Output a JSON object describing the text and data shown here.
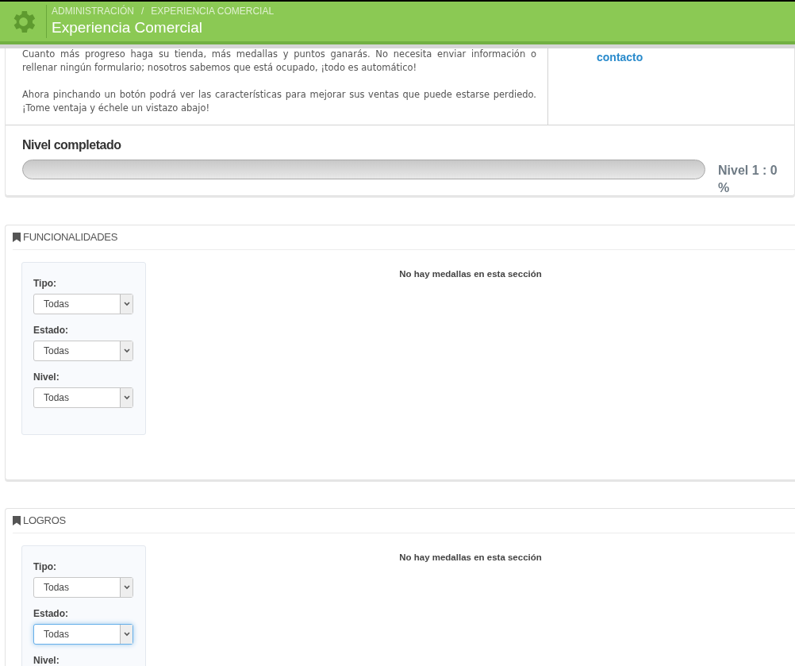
{
  "header": {
    "breadcrumb": [
      "ADMINISTRACIÓN",
      "EXPERIENCIA COMERCIAL"
    ],
    "separator": "/",
    "title": "Experiencia Comercial"
  },
  "intro": {
    "paragraphs": [
      "Cuanto más progreso haga su tienda, más medallas y puntos ganarás. No necesita enviar información o rellenar ningún formulario; nosotros sabemos que está ocupado, ¡todo es automático!",
      "Ahora pinchando un botón podrá ver las características para mejorar sus ventas que puede estarse perdiedo. ¡Tome ventaja y échele un vistazo abajo!"
    ],
    "link": "contacto"
  },
  "progress": {
    "heading": "Nivel completado",
    "level": 0,
    "reading": "Nivel 1 : 0 %"
  },
  "sections": [
    {
      "title": "FUNCIONALIDADES",
      "message": "No hay medallas en esta sección",
      "filters": [
        {
          "label": "Tipo:",
          "value": "Todas",
          "focused": false
        },
        {
          "label": "Estado:",
          "value": "Todas",
          "focused": false
        },
        {
          "label": "Nivel:",
          "value": "Todas",
          "focused": false
        }
      ]
    },
    {
      "title": "LOGROS",
      "message": "No hay medallas en esta sección",
      "filters": [
        {
          "label": "Tipo:",
          "value": "Todas",
          "focused": false
        },
        {
          "label": "Estado:",
          "value": "Todas",
          "focused": true
        },
        {
          "label": "Nivel:"
        }
      ]
    }
  ]
}
